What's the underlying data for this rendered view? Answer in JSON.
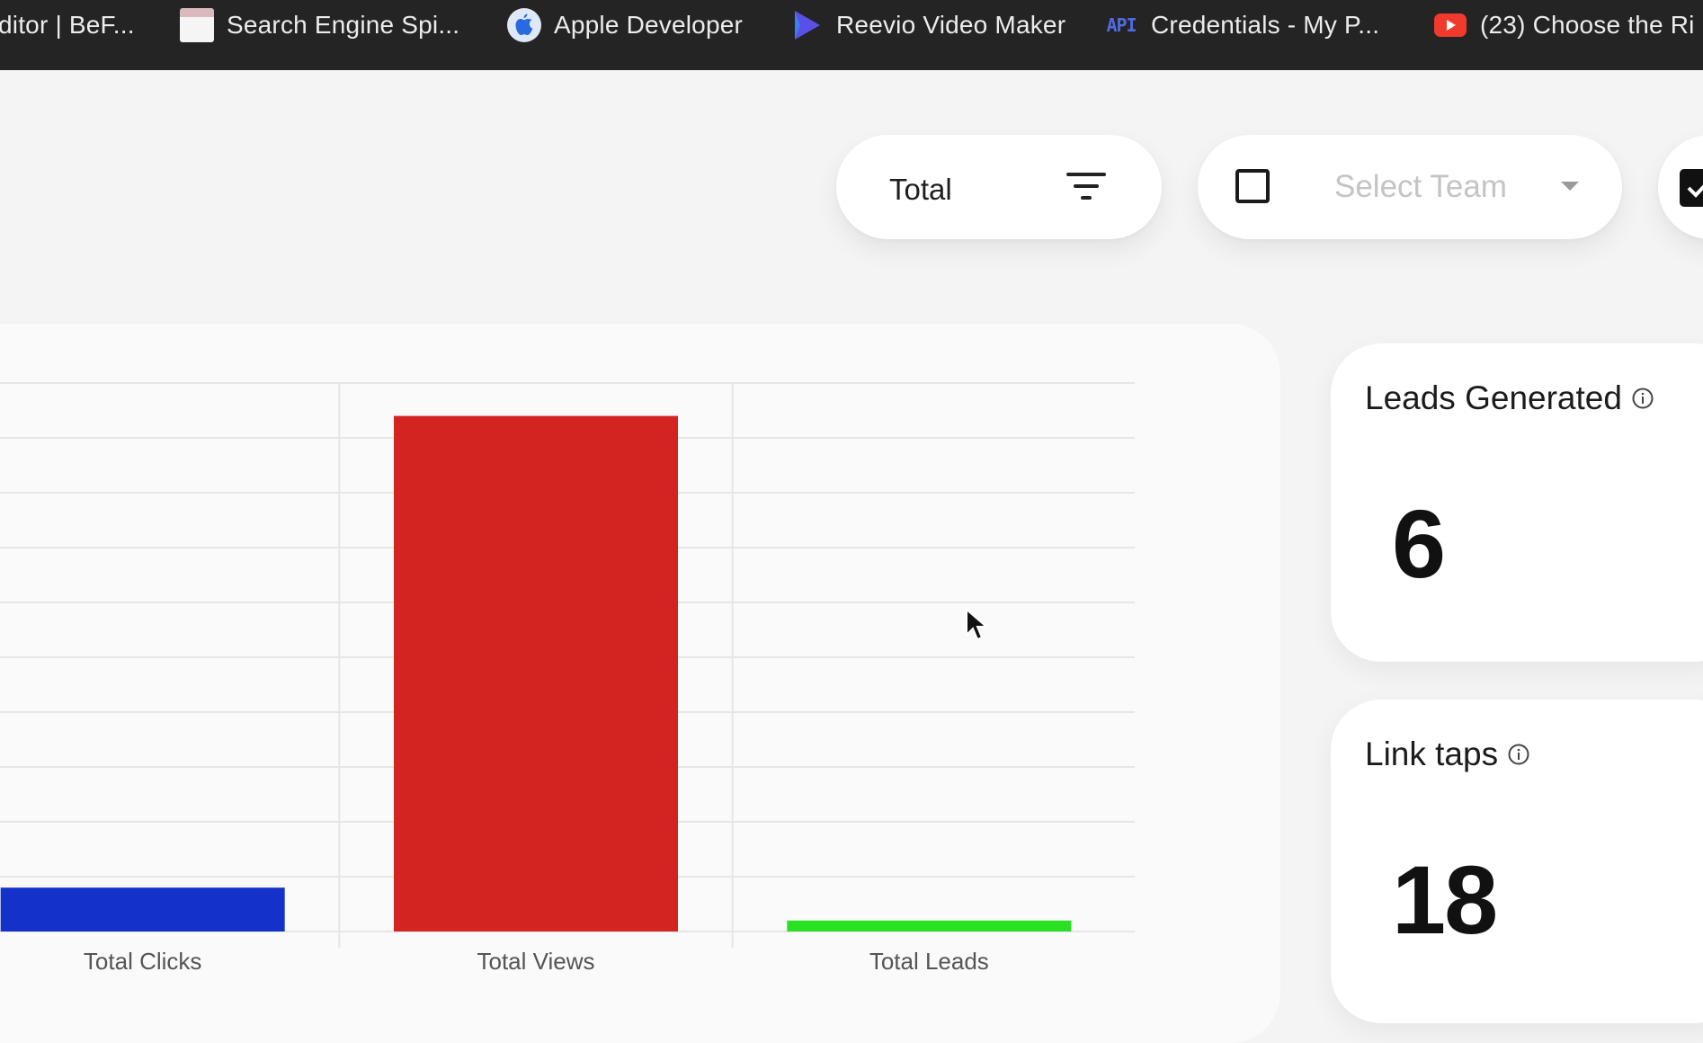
{
  "bookmarks": [
    {
      "label": "ditor | BeF...",
      "icon": "none"
    },
    {
      "label": "Search Engine Spi...",
      "icon": "mole-favicon-icon"
    },
    {
      "label": "Apple Developer",
      "icon": "apple-icon"
    },
    {
      "label": "Reevio Video Maker",
      "icon": "play-icon"
    },
    {
      "label": "Credentials - My P...",
      "icon": "api-icon"
    },
    {
      "label": "(23) Choose the Ri",
      "icon": "youtube-icon"
    }
  ],
  "controls": {
    "total_label": "Total",
    "team_placeholder": "Select Team"
  },
  "cards": {
    "leads": {
      "title": "Leads Generated",
      "value": "6"
    },
    "taps": {
      "title": "Link taps",
      "value": "18"
    }
  },
  "colors": {
    "clicks": "#1432c9",
    "views": "#d32421",
    "leads": "#29e022"
  },
  "chart_data": {
    "type": "bar",
    "categories": [
      "Total Clicks",
      "Total Views",
      "Total Leads"
    ],
    "values": [
      4,
      47,
      1
    ],
    "ylim": [
      0,
      50
    ],
    "grid": true,
    "colors": [
      "#1432c9",
      "#d32421",
      "#29e022"
    ]
  }
}
